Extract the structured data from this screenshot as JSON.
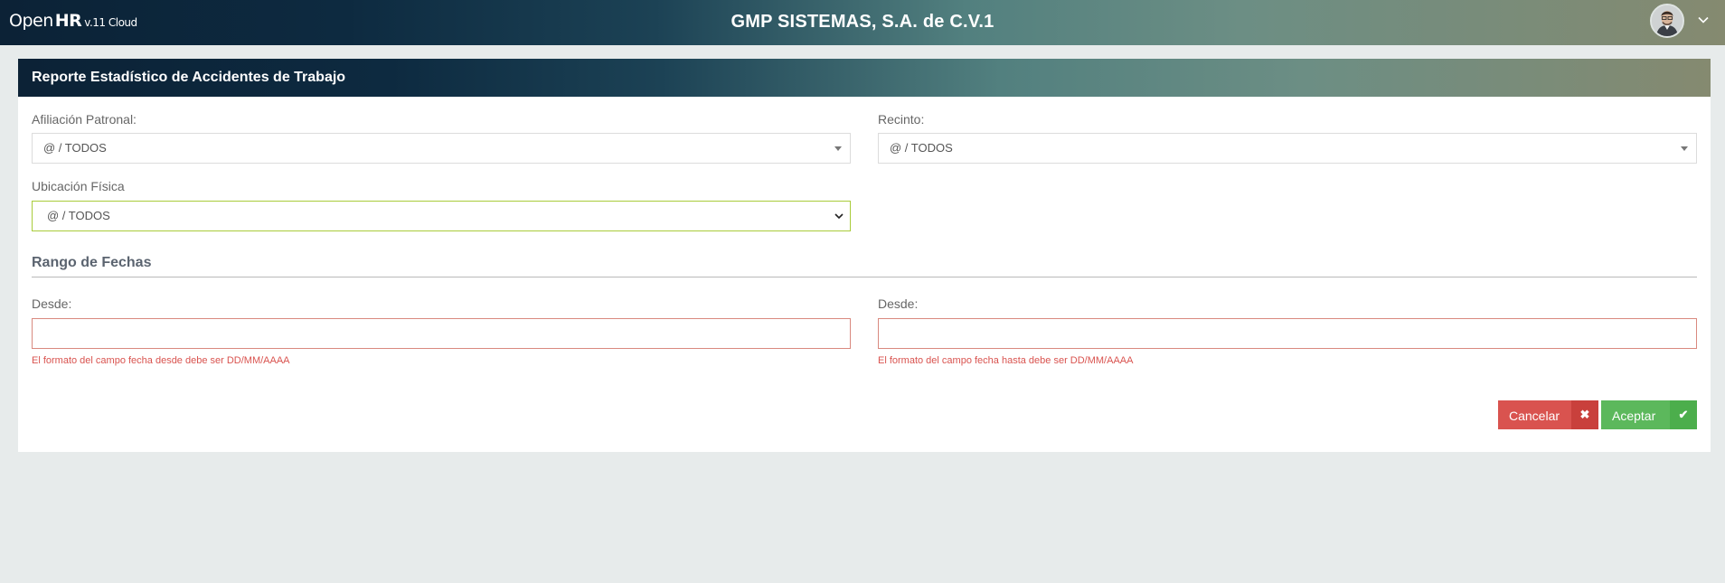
{
  "header": {
    "brand_open": "Open",
    "brand_hr": "HR",
    "brand_version": "v.11 Cloud",
    "company": "GMP SISTEMAS, S.A. de C.V.1"
  },
  "panel": {
    "title": "Reporte Estadístico de Accidentes de Trabajo"
  },
  "form": {
    "afiliacion": {
      "label": "Afiliación Patronal:",
      "value": "@ / TODOS"
    },
    "recinto": {
      "label": "Recinto:",
      "value": "@ / TODOS"
    },
    "ubicacion": {
      "label": "Ubicación Física",
      "value": "@ / TODOS"
    },
    "rango_title": "Rango de Fechas",
    "desde": {
      "label": "Desde:",
      "value": "",
      "error": "El formato del campo fecha desde debe ser DD/MM/AAAA"
    },
    "hasta": {
      "label": "Desde:",
      "value": "",
      "error": "El formato del campo fecha hasta debe ser DD/MM/AAAA"
    }
  },
  "buttons": {
    "cancel_label": "Cancelar",
    "cancel_icon": "✖",
    "ok_label": "Aceptar",
    "ok_icon": "✔"
  },
  "colors": {
    "cancel": "#d9534f",
    "accept": "#5cb85c",
    "error": "#d9534f",
    "focus_border": "#a9cc3b"
  }
}
